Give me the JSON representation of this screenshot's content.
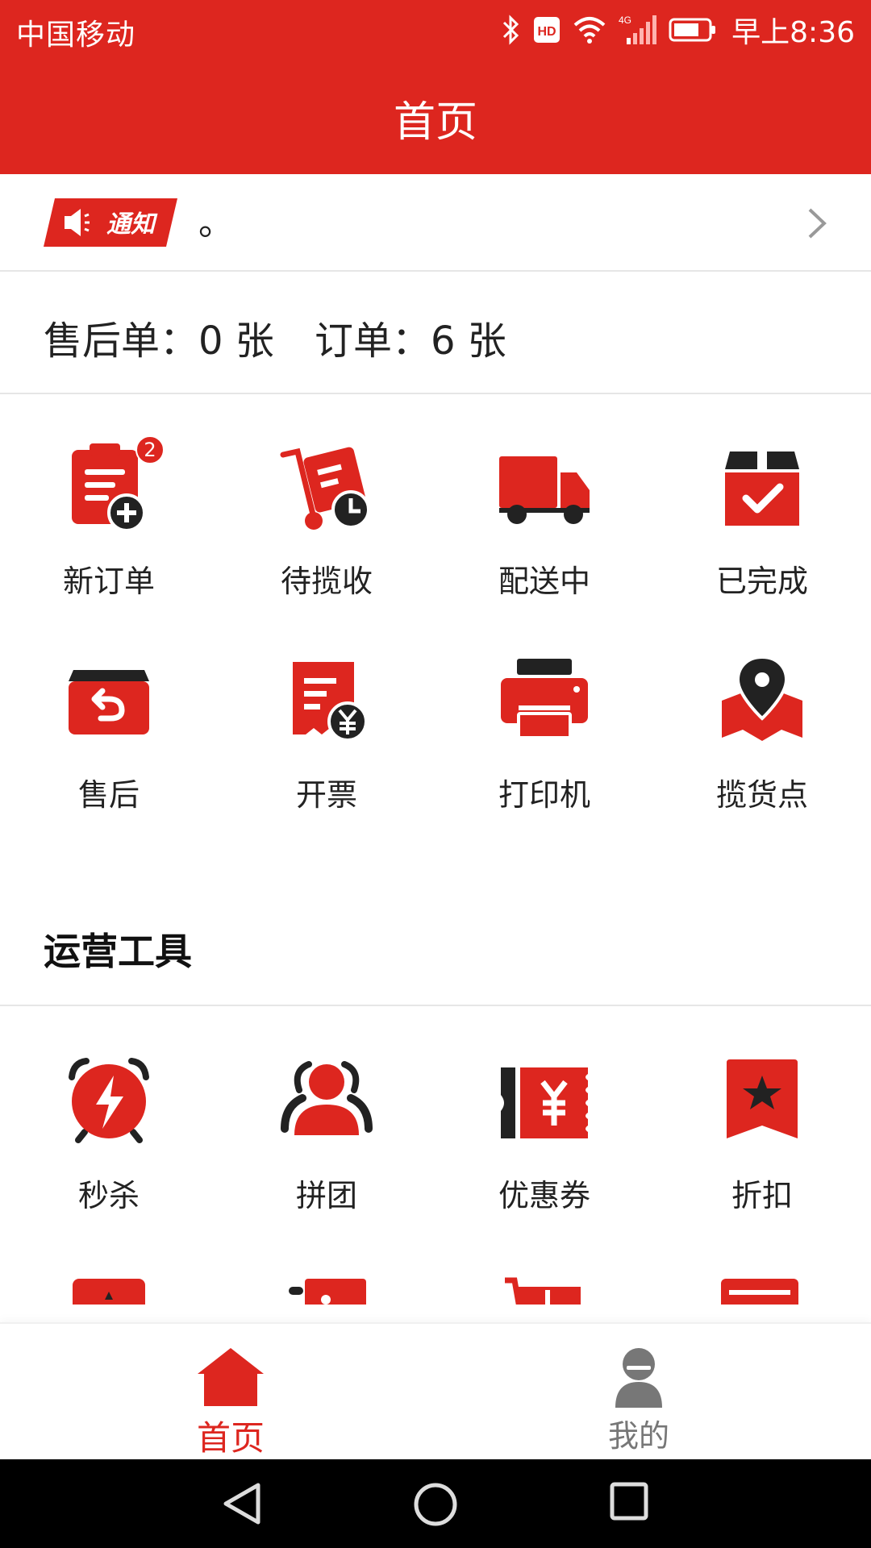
{
  "status": {
    "carrier": "中国移动",
    "time": "早上8:36",
    "hd": "HD",
    "net": "4G"
  },
  "header": {
    "title": "首页"
  },
  "notice": {
    "badge": "通知",
    "text": "。"
  },
  "counts": {
    "after_sale": "售后单：0 张",
    "orders": "订单：6 张"
  },
  "main_grid": [
    {
      "label": "新订单",
      "icon": "new-order-icon",
      "badge": "2"
    },
    {
      "label": "待揽收",
      "icon": "pending-pickup-icon"
    },
    {
      "label": "配送中",
      "icon": "delivery-truck-icon"
    },
    {
      "label": "已完成",
      "icon": "completed-box-icon"
    },
    {
      "label": "售后",
      "icon": "after-sale-icon"
    },
    {
      "label": "开票",
      "icon": "invoice-icon"
    },
    {
      "label": "打印机",
      "icon": "printer-icon"
    },
    {
      "label": "揽货点",
      "icon": "pickup-point-icon"
    }
  ],
  "tools": {
    "title": "运营工具",
    "items": [
      {
        "label": "秒杀",
        "icon": "flash-sale-icon"
      },
      {
        "label": "拼团",
        "icon": "group-buy-icon"
      },
      {
        "label": "优惠券",
        "icon": "coupon-icon"
      },
      {
        "label": "折扣",
        "icon": "discount-icon"
      }
    ]
  },
  "tabbar": [
    {
      "label": "首页",
      "icon": "home-icon"
    },
    {
      "label": "我的",
      "icon": "profile-icon"
    }
  ],
  "colors": {
    "brand": "#dd261f",
    "dark": "#222222"
  }
}
